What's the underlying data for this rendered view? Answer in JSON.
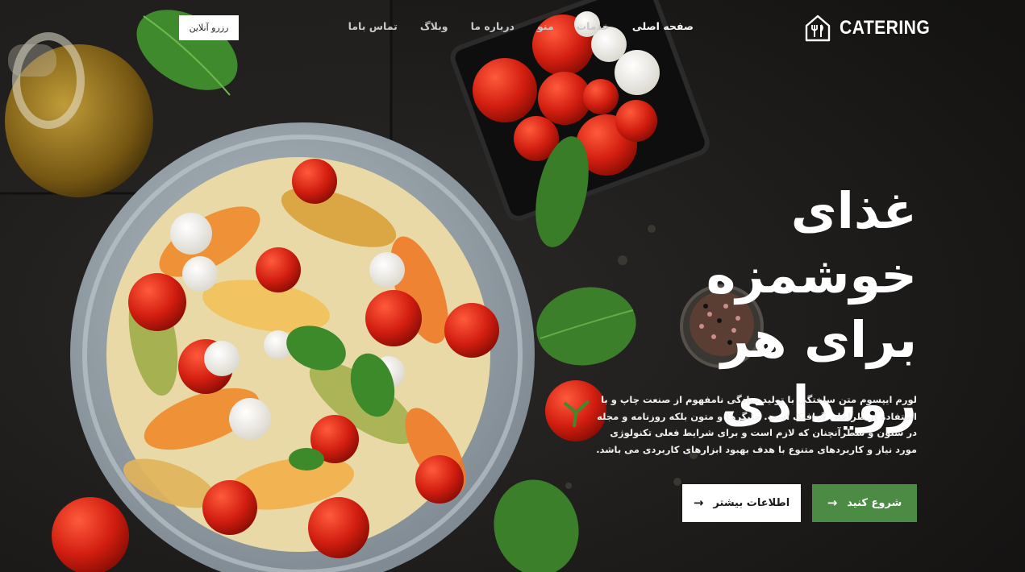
{
  "brand": {
    "name": "CATERING",
    "logo_icon": "house-cutlery-icon"
  },
  "nav": {
    "items": [
      {
        "label": "صفحه اصلی",
        "active": true
      },
      {
        "label": "خدمات",
        "active": false
      },
      {
        "label": "منو",
        "active": false
      },
      {
        "label": "درباره ما",
        "active": false
      },
      {
        "label": "وبلاگ",
        "active": false
      },
      {
        "label": "تماس باما",
        "active": false
      }
    ]
  },
  "header": {
    "reserve_label": "رزرو آنلاین"
  },
  "hero": {
    "title_lines": [
      "غذای خوشمزه",
      "برای هر",
      "رویدادی"
    ],
    "description": "لورم ایپسوم متن ساختگی با تولید سادگی نامفهوم از صنعت چاپ و با استفاده از طراحان گرافیک است. چاپگرها و متون بلکه روزنامه و مجله در ستون و سطرآنچنان که لازم است و برای شرایط فعلی تکنولوژی مورد نیاز و کاربردهای متنوع با هدف بهبود ابزارهای کاربردی می باشد.",
    "primary_button": {
      "label": "شروع کنید",
      "icon": "arrow-right-icon"
    },
    "secondary_button": {
      "label": "اطلاعات بیشتر",
      "icon": "arrow-right-icon"
    }
  },
  "colors": {
    "accent_green": "#4b8b44",
    "background_dark": "#1e1d1c",
    "text_white": "#ffffff"
  }
}
